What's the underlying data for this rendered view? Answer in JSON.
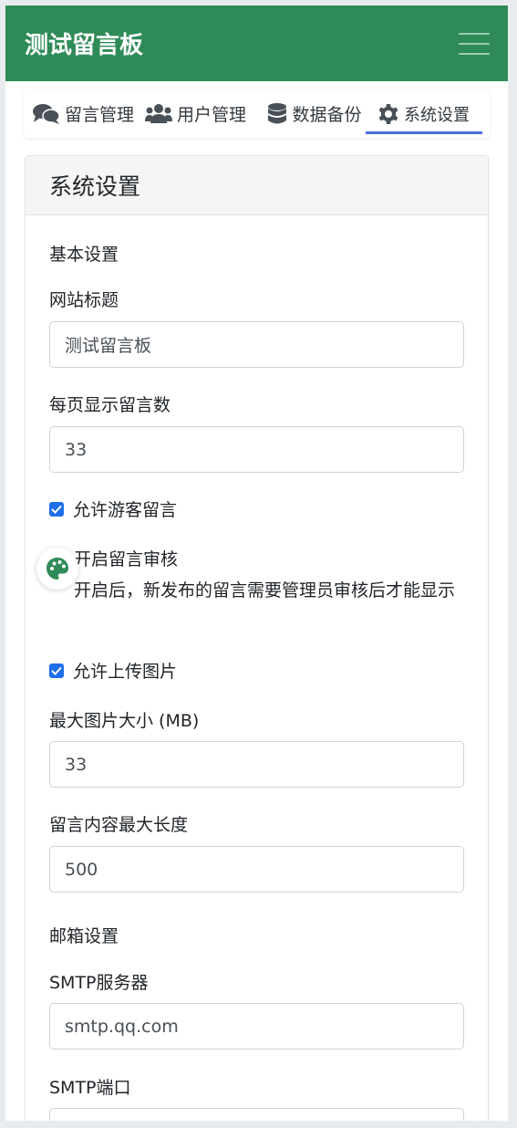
{
  "header": {
    "brand": "测试留言板",
    "menu_icon": "hamburger-icon"
  },
  "tabs": [
    {
      "label": "留言管理",
      "icon": "comments-icon"
    },
    {
      "label": "用户管理",
      "icon": "users-icon"
    },
    {
      "label": "数据备份",
      "icon": "database-icon"
    },
    {
      "label": "系统设置",
      "icon": "gear-icon",
      "active": true
    }
  ],
  "settings": {
    "title": "系统设置",
    "basic_section": "基本设置",
    "site_title_label": "网站标题",
    "site_title_value": "测试留言板",
    "per_page_label": "每页显示留言数",
    "per_page_value": "33",
    "allow_guest_label": "允许游客留言",
    "allow_guest_checked": true,
    "moderation_label": "开启留言审核",
    "moderation_desc": "开启后，新发布的留言需要管理员审核后才能显示",
    "allow_upload_label": "允许上传图片",
    "allow_upload_checked": true,
    "max_image_label": "最大图片大小 (MB)",
    "max_image_value": "33",
    "max_length_label": "留言内容最大长度",
    "max_length_value": "500",
    "mail_section": "邮箱设置",
    "smtp_server_label": "SMTP服务器",
    "smtp_server_value": "smtp.qq.com",
    "smtp_port_label": "SMTP端口"
  },
  "floating_button": {
    "icon": "palette-icon"
  },
  "colors": {
    "navbar": "#2e8b57",
    "accent": "#4a6fdc",
    "checkbox": "#1f6feb"
  }
}
